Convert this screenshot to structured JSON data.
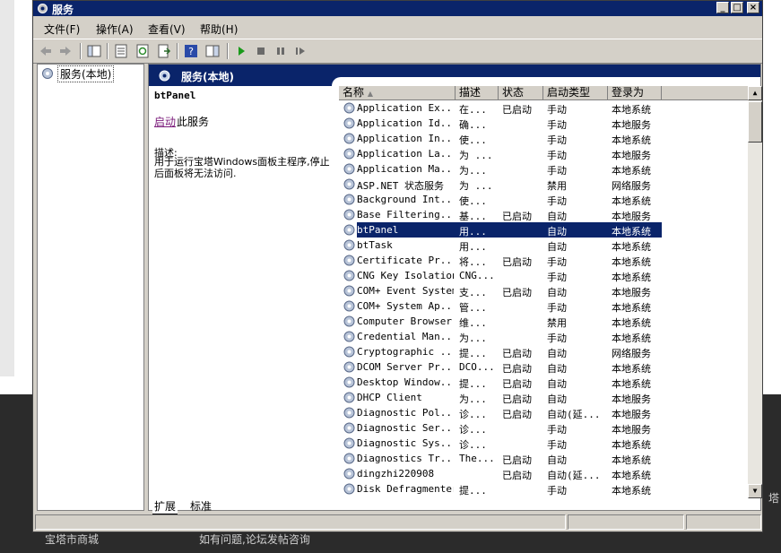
{
  "window": {
    "title": "服务"
  },
  "menu": [
    "文件(F)",
    "操作(A)",
    "查看(V)",
    "帮助(H)"
  ],
  "tree": {
    "root_label": "服务(本地)"
  },
  "pane": {
    "title": "服务(本地)"
  },
  "details": {
    "service_name": "btPanel",
    "start_link": "启动",
    "start_suffix": "此服务",
    "desc_label": "描述:",
    "desc_text": "用于运行宝塔Windows面板主程序,停止后面板将无法访问."
  },
  "columns": [
    "名称",
    "描述",
    "状态",
    "启动类型",
    "登录为"
  ],
  "services": [
    {
      "name": "Application Ex...",
      "desc": "在...",
      "status": "已启动",
      "startup": "手动",
      "logon": "本地系统"
    },
    {
      "name": "Application Id...",
      "desc": "确...",
      "status": "",
      "startup": "手动",
      "logon": "本地服务"
    },
    {
      "name": "Application In...",
      "desc": "使...",
      "status": "",
      "startup": "手动",
      "logon": "本地系统"
    },
    {
      "name": "Application La...",
      "desc": "为 ...",
      "status": "",
      "startup": "手动",
      "logon": "本地服务"
    },
    {
      "name": "Application Ma...",
      "desc": "为...",
      "status": "",
      "startup": "手动",
      "logon": "本地系统"
    },
    {
      "name": "ASP.NET 状态服务",
      "desc": "为 ...",
      "status": "",
      "startup": "禁用",
      "logon": "网络服务"
    },
    {
      "name": "Background Int...",
      "desc": "使...",
      "status": "",
      "startup": "手动",
      "logon": "本地系统"
    },
    {
      "name": "Base Filtering...",
      "desc": "基...",
      "status": "已启动",
      "startup": "自动",
      "logon": "本地服务"
    },
    {
      "name": "btPanel",
      "desc": "用...",
      "status": "",
      "startup": "自动",
      "logon": "本地系统",
      "selected": true
    },
    {
      "name": "btTask",
      "desc": "用...",
      "status": "",
      "startup": "自动",
      "logon": "本地系统"
    },
    {
      "name": "Certificate Pr...",
      "desc": "将...",
      "status": "已启动",
      "startup": "手动",
      "logon": "本地系统"
    },
    {
      "name": "CNG Key Isolation",
      "desc": "CNG...",
      "status": "",
      "startup": "手动",
      "logon": "本地系统"
    },
    {
      "name": "COM+ Event System",
      "desc": "支...",
      "status": "已启动",
      "startup": "自动",
      "logon": "本地服务"
    },
    {
      "name": "COM+ System Ap...",
      "desc": "管...",
      "status": "",
      "startup": "手动",
      "logon": "本地系统"
    },
    {
      "name": "Computer Browser",
      "desc": "维...",
      "status": "",
      "startup": "禁用",
      "logon": "本地系统"
    },
    {
      "name": "Credential Man...",
      "desc": "为...",
      "status": "",
      "startup": "手动",
      "logon": "本地系统"
    },
    {
      "name": "Cryptographic ...",
      "desc": "提...",
      "status": "已启动",
      "startup": "自动",
      "logon": "网络服务"
    },
    {
      "name": "DCOM Server Pr...",
      "desc": "DCO...",
      "status": "已启动",
      "startup": "自动",
      "logon": "本地系统"
    },
    {
      "name": "Desktop Window...",
      "desc": "提...",
      "status": "已启动",
      "startup": "自动",
      "logon": "本地系统"
    },
    {
      "name": "DHCP Client",
      "desc": "为...",
      "status": "已启动",
      "startup": "自动",
      "logon": "本地服务"
    },
    {
      "name": "Diagnostic Pol...",
      "desc": "诊...",
      "status": "已启动",
      "startup": "自动(延...",
      "logon": "本地服务"
    },
    {
      "name": "Diagnostic Ser...",
      "desc": "诊...",
      "status": "",
      "startup": "手动",
      "logon": "本地服务"
    },
    {
      "name": "Diagnostic Sys...",
      "desc": "诊...",
      "status": "",
      "startup": "手动",
      "logon": "本地系统"
    },
    {
      "name": "Diagnostics Tr...",
      "desc": "The...",
      "status": "已启动",
      "startup": "自动",
      "logon": "本地系统"
    },
    {
      "name": "dingzhi220908",
      "desc": "",
      "status": "已启动",
      "startup": "自动(延...",
      "logon": "本地系统"
    },
    {
      "name": "Disk Defragmenter",
      "desc": "提...",
      "status": "",
      "startup": "手动",
      "logon": "本地系统"
    }
  ],
  "tabs": {
    "extended": "扩展",
    "standard": "标准"
  },
  "background": {
    "footer_left": "宝塔市商城",
    "footer_mid": "如有问题,论坛发帖咨询",
    "side_char": "塔"
  },
  "colors": {
    "title_bar": "#0a246a",
    "selection": "#0a246a",
    "link": "#7a1a7a"
  }
}
